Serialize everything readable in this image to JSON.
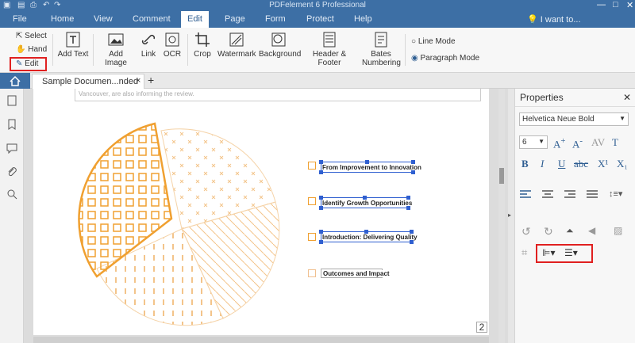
{
  "window": {
    "title": "PDFelement 6 Professional"
  },
  "menu": {
    "items": [
      "File",
      "Home",
      "View",
      "Comment",
      "Edit",
      "Page",
      "Form",
      "Protect",
      "Help"
    ],
    "active": "Edit",
    "search_placeholder": "I want to..."
  },
  "ribbon": {
    "select": "Select",
    "hand": "Hand",
    "edit": "Edit",
    "add_text": "Add Text",
    "add_image": "Add Image",
    "link": "Link",
    "ocr": "OCR",
    "crop": "Crop",
    "watermark": "Watermark",
    "background": "Background",
    "header_footer": "Header & Footer",
    "bates_line1": "Bates",
    "bates_line2": "Numbering",
    "line_mode": "Line Mode",
    "paragraph_mode": "Paragraph Mode"
  },
  "tabs": {
    "doc_title": "Sample Documen...nded",
    "close": "×",
    "add": "+"
  },
  "page": {
    "top_text": "Vancouver, are also informing the review.",
    "labels": [
      "From Improvement to Innovation",
      "Identify Growth Opportunities",
      "Introduction: Delivering Quality",
      "Outcomes and Impact"
    ],
    "page_number": "2"
  },
  "properties": {
    "title": "Properties",
    "font": "Helvetica Neue Bold",
    "font_size": "6",
    "bold": "B",
    "italic": "I",
    "underline": "U",
    "strike": "abc",
    "superscript": "X¹",
    "subscript": "X₁"
  },
  "colors": {
    "accent": "#3d6fa5",
    "pie_orange": "#f0a030",
    "selection": "#2f5fd0",
    "highlight_red": "#e02020"
  }
}
